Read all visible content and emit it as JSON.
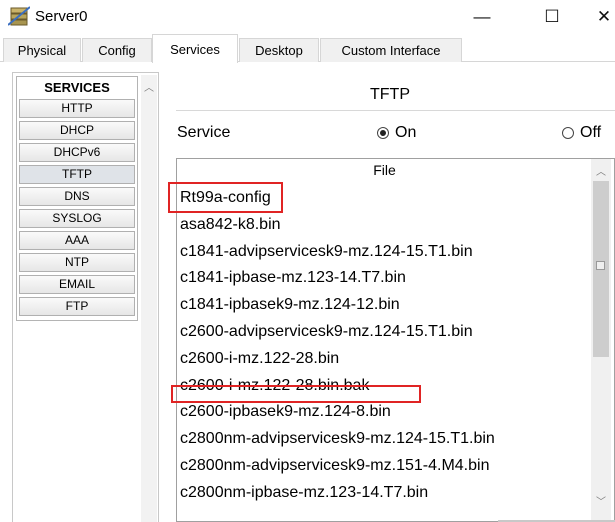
{
  "window": {
    "title": "Server0",
    "icon": "server-icon",
    "minimize_glyph": "—",
    "maximize_glyph": "☐",
    "close_glyph": "✕"
  },
  "tabs": [
    {
      "label": "Physical",
      "active": false
    },
    {
      "label": "Config",
      "active": false
    },
    {
      "label": "Services",
      "active": true
    },
    {
      "label": "Desktop",
      "active": false
    },
    {
      "label": "Custom Interface",
      "active": false
    }
  ],
  "services": {
    "header": "SERVICES",
    "items": [
      "HTTP",
      "DHCP",
      "DHCPv6",
      "TFTP",
      "DNS",
      "SYSLOG",
      "AAA",
      "NTP",
      "EMAIL",
      "FTP"
    ],
    "selected": "TFTP"
  },
  "tftp": {
    "title": "TFTP",
    "service_label": "Service",
    "on_label": "On",
    "off_label": "Off",
    "selected": "On"
  },
  "file_list": {
    "header": "File",
    "files": [
      "Rt99a-config",
      "asa842-k8.bin",
      "c1841-advipservicesk9-mz.124-15.T1.bin",
      "c1841-ipbase-mz.123-14.T7.bin",
      "c1841-ipbasek9-mz.124-12.bin",
      "c2600-advipservicesk9-mz.124-15.T1.bin",
      "c2600-i-mz.122-28.bin",
      "c2600-i-mz.122-28.bin.bak",
      "c2600-ipbasek9-mz.124-8.bin",
      "c2800nm-advipservicesk9-mz.124-15.T1.bin",
      "c2800nm-advipservicesk9-mz.151-4.M4.bin",
      "c2800nm-ipbase-mz.123-14.T7.bin"
    ]
  },
  "colors": {
    "highlight": "#e02424",
    "border": "#a0a0a0"
  }
}
